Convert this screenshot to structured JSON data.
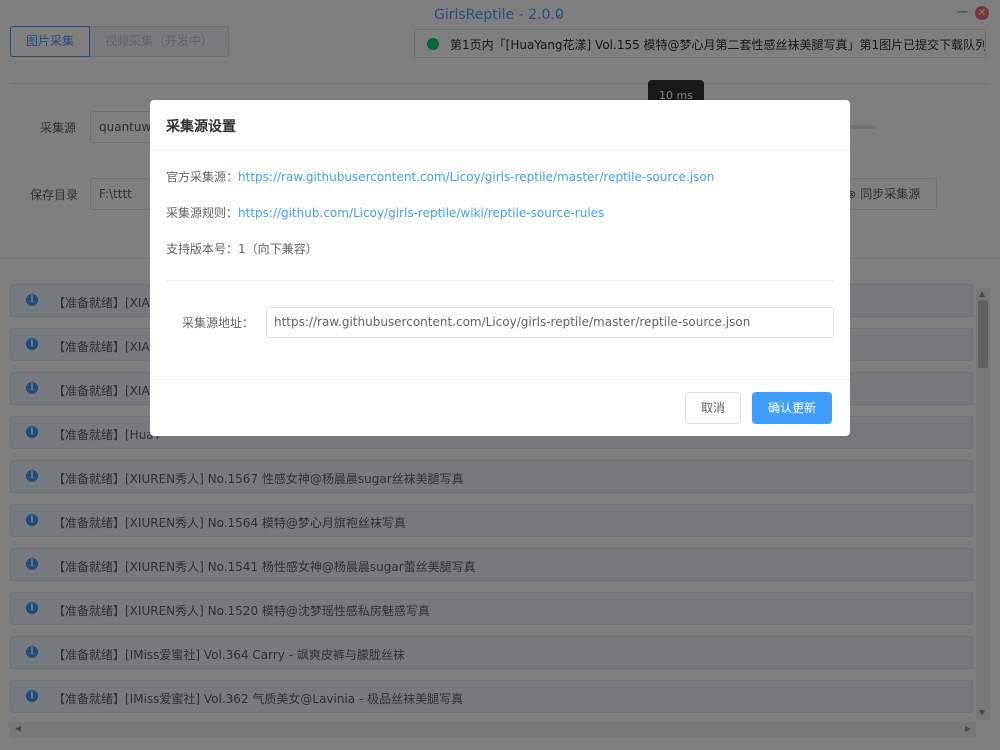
{
  "app": {
    "title": "GirlsReptile - 2.0.0",
    "title_chevron": "⌄",
    "minimize_glyph": "−",
    "close_glyph": "×"
  },
  "tabs": [
    {
      "label": "图片采集"
    },
    {
      "label": "视频采集（开发中）"
    }
  ],
  "status": {
    "text": "第1页内「[HuaYang花漾] Vol.155 模特@梦心月第二套性感丝袜美腿写真」第1图片已提交下载队列",
    "dot_color": "#13ce66"
  },
  "form": {
    "source_label": "采集源",
    "source_value": "quantuwa",
    "save_dir_label": "保存目录",
    "save_dir_value": "F:\\tttt",
    "interval_tooltip": "10 ms",
    "sync_button": "同步采集源",
    "sync_icon": "⊗"
  },
  "list": {
    "info_glyph": "i",
    "items": [
      "【准备就绪】[XIAO",
      "【准备就绪】[XIAO",
      "【准备就绪】[XIAO",
      "【准备就绪】[HuaY",
      "【准备就绪】[XIUREN秀人] No.1567 性感女神@杨晨晨sugar丝袜美腿写真",
      "【准备就绪】[XIUREN秀人] No.1564 模特@梦心月旗袍丝袜写真",
      "【准备就绪】[XIUREN秀人] No.1541 杨性感女神@杨晨晨sugar蕾丝美腿写真",
      "【准备就绪】[XIUREN秀人] No.1520 模特@沈梦瑶性感私房魅惑写真",
      "【准备就绪】[IMiss爱蜜社] Vol.364 Carry - 飒爽皮裤与朦胧丝袜",
      "【准备就绪】[IMiss爱蜜社] Vol.362 气质美女@Lavinia - 极品丝袜美腿写真"
    ]
  },
  "dialog": {
    "title": "采集源设置",
    "official_label": "官方采集源：",
    "official_url": "https://raw.githubusercontent.com/Licoy/girls-reptile/master/reptile-source.json",
    "rules_label": "采集源规则：",
    "rules_url": "https://github.com/Licoy/girls-reptile/wiki/reptile-source-rules",
    "version_text": "支持版本号：1（向下兼容）",
    "field_label": "采集源地址：",
    "field_value": "https://raw.githubusercontent.com/Licoy/girls-reptile/master/reptile-source.json",
    "cancel_label": "取消",
    "confirm_label": "确认更新"
  },
  "colors": {
    "accent": "#409eff",
    "overlay": "rgba(0,0,0,0.5)"
  }
}
